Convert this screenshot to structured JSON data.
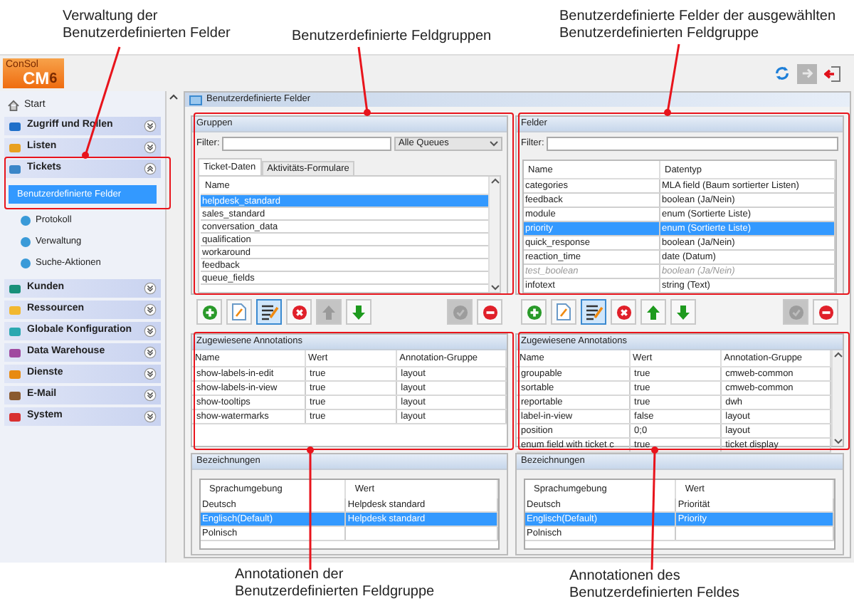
{
  "callouts_top": [
    {
      "lines": [
        "Verwaltung der",
        "Benutzerdefinierten Felder"
      ]
    },
    {
      "lines": [
        "Benutzerdefinierte Feldgruppen"
      ]
    },
    {
      "lines": [
        "Benutzerdefinierte Felder der ausgewählten",
        "Benutzerdefinierten Feldgruppe"
      ]
    }
  ],
  "logo": {
    "brand": "ConSol",
    "product": "CM",
    "version": "6"
  },
  "header_actions": [
    {
      "kind": "refresh",
      "disabled": false
    },
    {
      "kind": "forward",
      "disabled": true
    },
    {
      "kind": "logout",
      "disabled": false
    }
  ],
  "sidebar": {
    "start": "Start",
    "sections": [
      {
        "label": "Zugriff und Rollen",
        "expanded": false
      },
      {
        "label": "Listen",
        "expanded": false
      },
      {
        "label": "Tickets",
        "expanded": true,
        "children": [
          {
            "label": "Benutzerdefinierte Felder",
            "selected": true
          },
          {
            "label": "Protokoll",
            "selected": false
          },
          {
            "label": "Verwaltung",
            "selected": false
          },
          {
            "label": "Suche-Aktionen",
            "selected": false
          }
        ]
      },
      {
        "label": "Kunden",
        "expanded": false
      },
      {
        "label": "Ressourcen",
        "expanded": false
      },
      {
        "label": "Globale Konfiguration",
        "expanded": false
      },
      {
        "label": "Data Warehouse",
        "expanded": false
      },
      {
        "label": "Dienste",
        "expanded": false
      },
      {
        "label": "E-Mail",
        "expanded": false
      },
      {
        "label": "System",
        "expanded": false
      }
    ]
  },
  "main_title": "Benutzerdefinierte Felder",
  "groups": {
    "title": "Gruppen",
    "filter_label": "Filter:",
    "queue_select": "Alle Queues",
    "tabs": [
      {
        "label": "Ticket-Daten",
        "selected": true
      },
      {
        "label": "Aktivitäts-Formulare",
        "selected": false
      }
    ],
    "column": "Name",
    "rows": [
      {
        "name": "helpdesk_standard",
        "selected": true
      },
      {
        "name": "sales_standard",
        "selected": false
      },
      {
        "name": "conversation_data",
        "selected": false
      },
      {
        "name": "qualification",
        "selected": false
      },
      {
        "name": "workaround",
        "selected": false
      },
      {
        "name": "feedback",
        "selected": false
      },
      {
        "name": "queue_fields",
        "selected": false
      }
    ],
    "toolbar": [
      {
        "kind": "add",
        "disabled": false,
        "pressed": false
      },
      {
        "kind": "new",
        "disabled": false,
        "pressed": false
      },
      {
        "kind": "edit",
        "disabled": false,
        "pressed": true
      },
      {
        "kind": "delete",
        "disabled": false,
        "pressed": false
      },
      {
        "kind": "up",
        "disabled": true,
        "pressed": false
      },
      {
        "kind": "down",
        "disabled": false,
        "pressed": false
      },
      {
        "kind": "check",
        "disabled": true,
        "pressed": false
      },
      {
        "kind": "remove",
        "disabled": false,
        "pressed": false
      }
    ]
  },
  "fields": {
    "title": "Felder",
    "filter_label": "Filter:",
    "columns": [
      "Name",
      "Datentyp"
    ],
    "rows": [
      {
        "name": "categories",
        "type": "MLA field (Baum sortierter Listen)",
        "selected": false,
        "disabled": false
      },
      {
        "name": "feedback",
        "type": "boolean (Ja/Nein)",
        "selected": false,
        "disabled": false
      },
      {
        "name": "module",
        "type": "enum (Sortierte Liste)",
        "selected": false,
        "disabled": false
      },
      {
        "name": "priority",
        "type": "enum (Sortierte Liste)",
        "selected": true,
        "disabled": false
      },
      {
        "name": "quick_response",
        "type": "boolean (Ja/Nein)",
        "selected": false,
        "disabled": false
      },
      {
        "name": "reaction_time",
        "type": "date (Datum)",
        "selected": false,
        "disabled": false
      },
      {
        "name": "test_boolean",
        "type": "boolean (Ja/Nein)",
        "selected": false,
        "disabled": true
      },
      {
        "name": "infotext",
        "type": "string (Text)",
        "selected": false,
        "disabled": false
      }
    ],
    "toolbar": [
      {
        "kind": "add",
        "disabled": false,
        "pressed": false
      },
      {
        "kind": "new",
        "disabled": false,
        "pressed": false
      },
      {
        "kind": "edit",
        "disabled": false,
        "pressed": true
      },
      {
        "kind": "delete",
        "disabled": false,
        "pressed": false
      },
      {
        "kind": "up",
        "disabled": false,
        "pressed": false
      },
      {
        "kind": "down",
        "disabled": false,
        "pressed": false
      },
      {
        "kind": "check",
        "disabled": true,
        "pressed": false
      },
      {
        "kind": "remove",
        "disabled": false,
        "pressed": false
      }
    ]
  },
  "group_annotations": {
    "title": "Zugewiesene Annotations",
    "columns": [
      "Name",
      "Wert",
      "Annotation-Gruppe"
    ],
    "rows": [
      [
        "show-labels-in-edit",
        "true",
        "layout"
      ],
      [
        "show-labels-in-view",
        "true",
        "layout"
      ],
      [
        "show-tooltips",
        "true",
        "layout"
      ],
      [
        "show-watermarks",
        "true",
        "layout"
      ]
    ]
  },
  "field_annotations": {
    "title": "Zugewiesene Annotations",
    "columns": [
      "Name",
      "Wert",
      "Annotation-Gruppe"
    ],
    "rows": [
      [
        "groupable",
        "true",
        "cmweb-common"
      ],
      [
        "sortable",
        "true",
        "cmweb-common"
      ],
      [
        "reportable",
        "true",
        "dwh"
      ],
      [
        "label-in-view",
        "false",
        "layout"
      ],
      [
        "position",
        "0;0",
        "layout"
      ],
      [
        "enum field with ticket c",
        "true",
        "ticket display"
      ]
    ]
  },
  "group_labels": {
    "title": "Bezeichnungen",
    "columns": [
      "Sprachumgebung",
      "Wert"
    ],
    "rows": [
      {
        "locale": "Deutsch",
        "value": "Helpdesk standard",
        "selected": false
      },
      {
        "locale": "Englisch(Default)",
        "value": "Helpdesk standard",
        "selected": true
      },
      {
        "locale": "Polnisch",
        "value": "",
        "selected": false
      }
    ]
  },
  "field_labels": {
    "title": "Bezeichnungen",
    "columns": [
      "Sprachumgebung",
      "Wert"
    ],
    "rows": [
      {
        "locale": "Deutsch",
        "value": "Priorität",
        "selected": false
      },
      {
        "locale": "Englisch(Default)",
        "value": "Priority",
        "selected": true
      },
      {
        "locale": "Polnisch",
        "value": "",
        "selected": false
      }
    ]
  },
  "callouts_bottom": [
    {
      "lines": [
        "Annotationen der",
        "Benutzerdefinierten Feldgruppe"
      ]
    },
    {
      "lines": [
        "Annotationen des",
        "Benutzerdefinierten Feldes"
      ]
    }
  ]
}
